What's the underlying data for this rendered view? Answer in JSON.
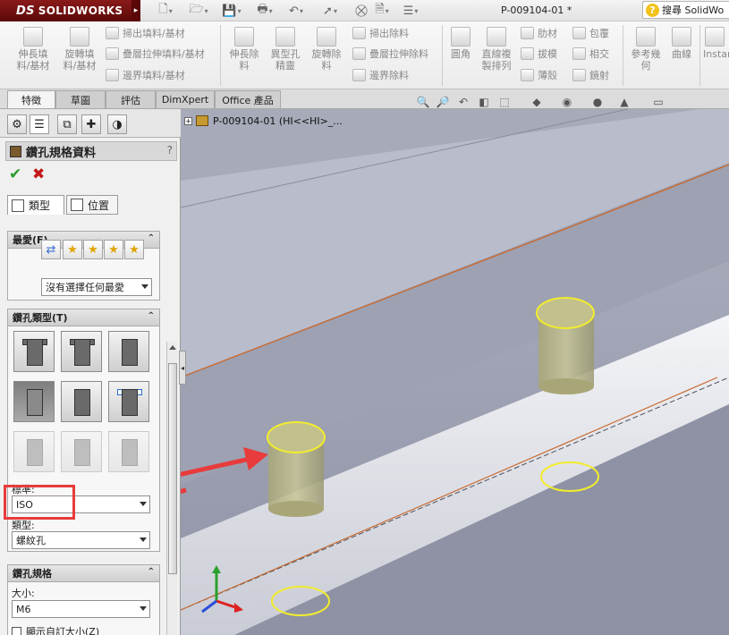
{
  "app": {
    "brand": "SOLIDWORKS",
    "brand_prefix": "DS",
    "document_title": "P-009104-01 *",
    "search_text": "搜尋 SolidWo"
  },
  "quick_access": [
    {
      "icon": "new-doc-icon"
    },
    {
      "icon": "open-icon"
    },
    {
      "icon": "save-icon"
    },
    {
      "icon": "print-icon"
    },
    {
      "icon": "undo-icon"
    },
    {
      "icon": "select-arrow-icon"
    },
    {
      "icon": "rebuild-icon"
    },
    {
      "icon": "file-properties-icon"
    },
    {
      "icon": "options-icon"
    }
  ],
  "ribbon": {
    "extruded_boss": "伸長填\n料/基材",
    "revolved_boss": "旋轉填\n料/基材",
    "swept_boss": "掃出填料/基材",
    "lofted_boss": "疊層拉伸填料/基材",
    "boundary_boss": "邊界填料/基材",
    "extruded_cut": "伸長除\n料",
    "hole_wizard": "異型孔\n精靈",
    "revolved_cut": "旋轉除\n料",
    "swept_cut": "掃出除料",
    "lofted_cut": "疊層拉伸除料",
    "boundary_cut": "邊界除料",
    "fillet": "圓角",
    "linear_pattern": "直線複\n製排列",
    "rib": "肋材",
    "draft": "拔模",
    "shell": "薄殼",
    "wrap": "包覆",
    "intersect": "相交",
    "mirror": "鏡射",
    "reference_geometry": "參考幾\n何",
    "curves": "曲線",
    "instant3d": "Instan"
  },
  "tabs": [
    {
      "label": "特徵",
      "active": true
    },
    {
      "label": "草圖",
      "active": false
    },
    {
      "label": "評估",
      "active": false
    },
    {
      "label": "DimXpert",
      "active": false
    },
    {
      "label": "Office 產品",
      "active": false
    }
  ],
  "feature_tree": {
    "item": "P-009104-01  (HI<<HI>_..."
  },
  "property_manager": {
    "title": "鑽孔規格資料",
    "help": "?",
    "ok": "✔",
    "cancel": "✖",
    "subtabs": {
      "type": "類型",
      "position": "位置"
    },
    "favorites": {
      "header": "最愛(F)",
      "selection": "沒有選擇任何最愛"
    },
    "hole_type": {
      "header": "鑽孔類型(T)",
      "standard_label": "標準:",
      "standard_value": "ISO",
      "type_label": "類型:",
      "type_value": "螺紋孔"
    },
    "hole_spec": {
      "header": "鑽孔規格",
      "size_label": "大小:",
      "size_value": "M6",
      "custom_size_label": "顯示自訂大小(Z)"
    }
  },
  "colors": {
    "annotation_red": "#e83b3b",
    "hole_highlight": "#f2ec2e",
    "model_face": "#9a9eaf"
  }
}
